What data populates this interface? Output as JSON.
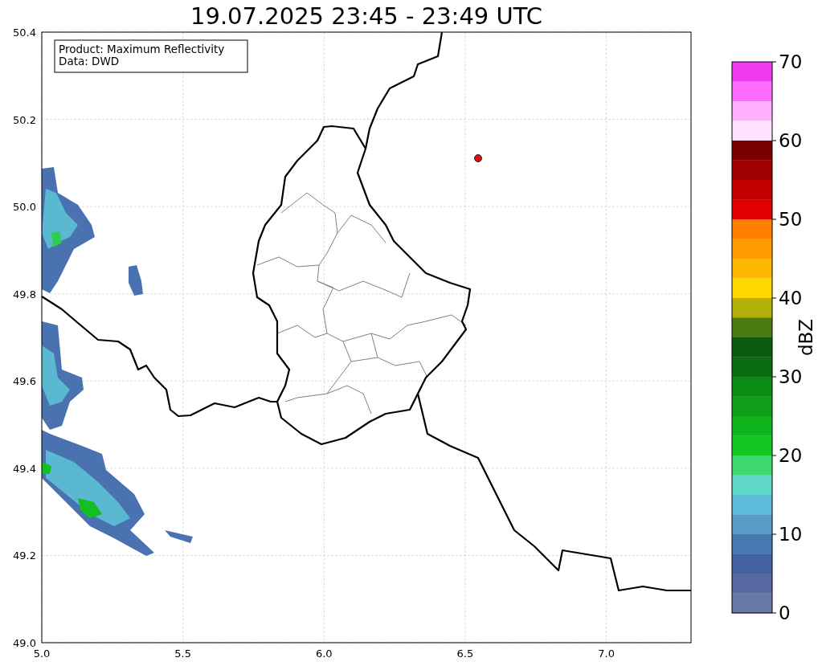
{
  "title": "19.07.2025 23:45 - 23:49 UTC",
  "map": {
    "info_box": [
      "Product: Maximum Reflectivity",
      "Data: DWD"
    ],
    "x_ticks": [
      "5.0",
      "5.5",
      "6.0",
      "6.5",
      "7.0"
    ],
    "y_ticks": [
      "50.4",
      "50.2",
      "50.0",
      "49.8",
      "49.6",
      "49.4",
      "49.2",
      "49.0"
    ]
  },
  "colorbar": {
    "label": "dBZ",
    "ticks": [
      "70",
      "60",
      "50",
      "40",
      "30",
      "20",
      "10",
      "0"
    ],
    "segments": [
      {
        "color": "#f03cf0"
      },
      {
        "color": "#ff6cff"
      },
      {
        "color": "#ffb0ff"
      },
      {
        "color": "#ffe0ff"
      },
      {
        "color": "#780000"
      },
      {
        "color": "#a00000"
      },
      {
        "color": "#c40000"
      },
      {
        "color": "#e00000"
      },
      {
        "color": "#ff7e00"
      },
      {
        "color": "#ff9a00"
      },
      {
        "color": "#ffb800"
      },
      {
        "color": "#ffd800"
      },
      {
        "color": "#b0b008"
      },
      {
        "color": "#4a7a10"
      },
      {
        "color": "#0a5a10"
      },
      {
        "color": "#0a6c12"
      },
      {
        "color": "#0c8a14"
      },
      {
        "color": "#0e9e18"
      },
      {
        "color": "#10b41c"
      },
      {
        "color": "#12c820"
      },
      {
        "color": "#3ed870"
      },
      {
        "color": "#60d8c8"
      },
      {
        "color": "#60bcdc"
      },
      {
        "color": "#5a9cc8"
      },
      {
        "color": "#4a78b0"
      },
      {
        "color": "#4460a0"
      },
      {
        "color": "#5568a0"
      },
      {
        "color": "#6677a8"
      }
    ]
  }
}
